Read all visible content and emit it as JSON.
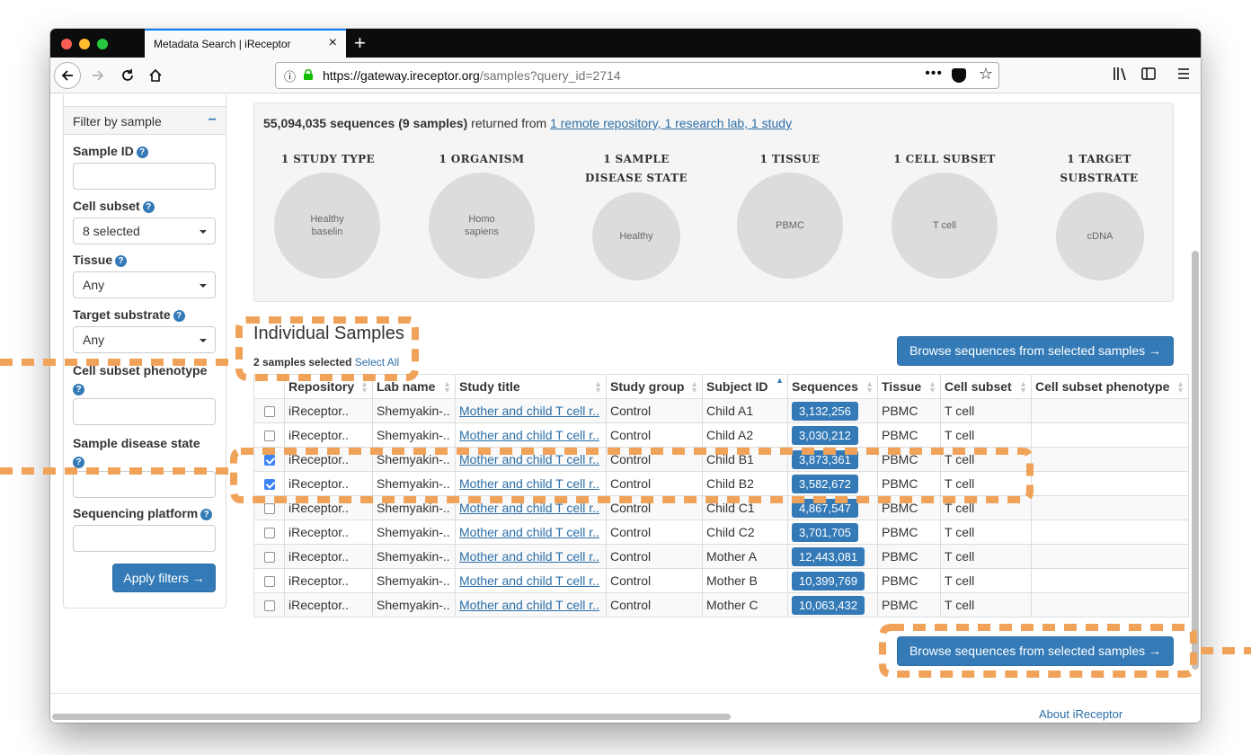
{
  "browser": {
    "tab_title": "Metadata Search | iReceptor",
    "tab_close": "×",
    "new_tab": "+",
    "url_host": "https://gateway.ireceptor.org",
    "url_path": "/samples?query_id=2714",
    "more_glyph": "•••"
  },
  "sidebar": {
    "header": "Filter by sample",
    "collapse_glyph": "−",
    "help_glyph": "?",
    "fields": {
      "sample_id": {
        "label": "Sample ID",
        "value": ""
      },
      "cell_subset": {
        "label": "Cell subset",
        "value": "8 selected"
      },
      "tissue": {
        "label": "Tissue",
        "value": "Any"
      },
      "target_substrate": {
        "label": "Target substrate",
        "value": "Any"
      },
      "cell_subset_phenotype": {
        "label": "Cell subset phenotype",
        "value": ""
      },
      "sample_disease_state": {
        "label": "Sample disease state",
        "value": ""
      },
      "sequencing_platform": {
        "label": "Sequencing platform",
        "value": ""
      }
    },
    "apply_label": "Apply filters →"
  },
  "summary": {
    "count_text": "55,094,035 sequences (9 samples)",
    "returned_from": " returned from ",
    "sources_link": "1 remote repository, 1 research lab, 1 study",
    "stats": [
      {
        "label_line1": "1 STUDY TYPE",
        "label_line2": "",
        "value_line1": "Healthy",
        "value_line2": "baselin"
      },
      {
        "label_line1": "1 ORGANISM",
        "label_line2": "",
        "value_line1": "Homo",
        "value_line2": "sapiens"
      },
      {
        "label_line1": "1 SAMPLE",
        "label_line2": "DISEASE STATE",
        "value_line1": "Healthy",
        "value_line2": ""
      },
      {
        "label_line1": "1 TISSUE",
        "label_line2": "",
        "value_line1": "PBMC",
        "value_line2": ""
      },
      {
        "label_line1": "1 CELL SUBSET",
        "label_line2": "",
        "value_line1": "T cell",
        "value_line2": ""
      },
      {
        "label_line1": "1 TARGET",
        "label_line2": "SUBSTRATE",
        "value_line1": "cDNA",
        "value_line2": ""
      }
    ]
  },
  "samples": {
    "title": "Individual Samples",
    "selected_text": "2 samples selected",
    "select_all": "Select All",
    "browse_label": "Browse sequences from selected samples →",
    "columns": [
      "Repository",
      "Lab name",
      "Study title",
      "Study group",
      "Subject ID",
      "Sequences",
      "Tissue",
      "Cell subset",
      "Cell subset phenotype"
    ],
    "sort_glyph": "▲▼",
    "sort_active_glyph": "▲",
    "rows": [
      {
        "checked": false,
        "repository": "iReceptor..",
        "lab": "Shemyakin-..",
        "study": "Mother and child T cell r..",
        "group": "Control",
        "subject": "Child A1",
        "sequences": "3,132,256",
        "tissue": "PBMC",
        "cell_subset": "T cell",
        "phenotype": ""
      },
      {
        "checked": false,
        "repository": "iReceptor..",
        "lab": "Shemyakin-..",
        "study": "Mother and child T cell r..",
        "group": "Control",
        "subject": "Child A2",
        "sequences": "3,030,212",
        "tissue": "PBMC",
        "cell_subset": "T cell",
        "phenotype": ""
      },
      {
        "checked": true,
        "repository": "iReceptor..",
        "lab": "Shemyakin-..",
        "study": "Mother and child T cell r..",
        "group": "Control",
        "subject": "Child B1",
        "sequences": "3,873,361",
        "tissue": "PBMC",
        "cell_subset": "T cell",
        "phenotype": ""
      },
      {
        "checked": true,
        "repository": "iReceptor..",
        "lab": "Shemyakin-..",
        "study": "Mother and child T cell r..",
        "group": "Control",
        "subject": "Child B2",
        "sequences": "3,582,672",
        "tissue": "PBMC",
        "cell_subset": "T cell",
        "phenotype": ""
      },
      {
        "checked": false,
        "repository": "iReceptor..",
        "lab": "Shemyakin-..",
        "study": "Mother and child T cell r..",
        "group": "Control",
        "subject": "Child C1",
        "sequences": "4,867,547",
        "tissue": "PBMC",
        "cell_subset": "T cell",
        "phenotype": ""
      },
      {
        "checked": false,
        "repository": "iReceptor..",
        "lab": "Shemyakin-..",
        "study": "Mother and child T cell r..",
        "group": "Control",
        "subject": "Child C2",
        "sequences": "3,701,705",
        "tissue": "PBMC",
        "cell_subset": "T cell",
        "phenotype": ""
      },
      {
        "checked": false,
        "repository": "iReceptor..",
        "lab": "Shemyakin-..",
        "study": "Mother and child T cell r..",
        "group": "Control",
        "subject": "Mother A",
        "sequences": "12,443,081",
        "tissue": "PBMC",
        "cell_subset": "T cell",
        "phenotype": ""
      },
      {
        "checked": false,
        "repository": "iReceptor..",
        "lab": "Shemyakin-..",
        "study": "Mother and child T cell r..",
        "group": "Control",
        "subject": "Mother B",
        "sequences": "10,399,769",
        "tissue": "PBMC",
        "cell_subset": "T cell",
        "phenotype": ""
      },
      {
        "checked": false,
        "repository": "iReceptor..",
        "lab": "Shemyakin-..",
        "study": "Mother and child T cell r..",
        "group": "Control",
        "subject": "Mother C",
        "sequences": "10,063,432",
        "tissue": "PBMC",
        "cell_subset": "T cell",
        "phenotype": ""
      }
    ]
  },
  "footer": {
    "link": "About iReceptor"
  },
  "colors": {
    "accent": "#337ab7",
    "annotation": "#f0a259",
    "link": "#2c6fa8"
  }
}
